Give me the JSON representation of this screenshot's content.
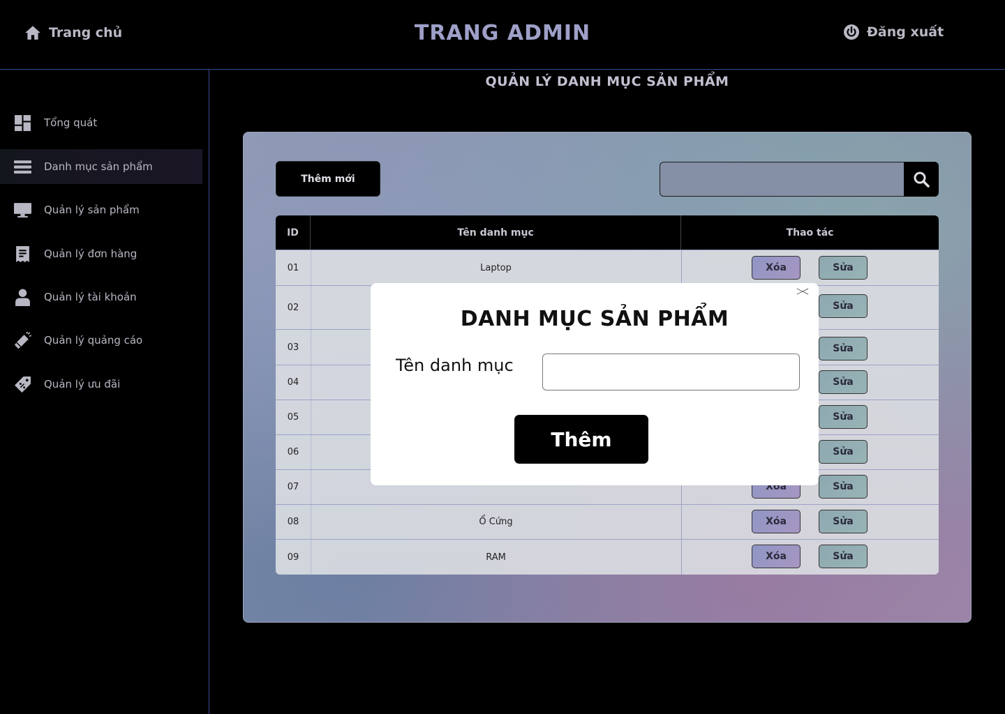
{
  "header": {
    "home_label": "Trang chủ",
    "title": "TRANG ADMIN",
    "logout_label": "Đăng xuất"
  },
  "sidebar": {
    "items": [
      {
        "label": "Tổng quát",
        "icon": "dashboard-icon"
      },
      {
        "label": "Danh mục sản phẩm",
        "icon": "list-icon",
        "active": true
      },
      {
        "label": "Quản lý sản phẩm",
        "icon": "monitor-icon"
      },
      {
        "label": "Quản lý đơn hàng",
        "icon": "receipt-icon"
      },
      {
        "label": "Quản lý tài khoản",
        "icon": "user-icon"
      },
      {
        "label": "Quản lý quảng cáo",
        "icon": "megaphone-icon"
      },
      {
        "label": "Quản lý ưu đãi",
        "icon": "discount-tag-icon"
      }
    ]
  },
  "main": {
    "section_title": "QUẢN LÝ DANH MỤC SẢN PHẨM",
    "add_new_label": "Thêm mới",
    "search": {
      "value": "",
      "icon": "search-icon"
    },
    "table": {
      "columns": [
        "ID",
        "Tên danh mục",
        "Thao tác"
      ],
      "rows": [
        {
          "id": "01",
          "name": "Laptop"
        },
        {
          "id": "02",
          "name": ""
        },
        {
          "id": "03",
          "name": ""
        },
        {
          "id": "04",
          "name": ""
        },
        {
          "id": "05",
          "name": ""
        },
        {
          "id": "06",
          "name": ""
        },
        {
          "id": "07",
          "name": ""
        },
        {
          "id": "08",
          "name": "Ổ Cứng"
        },
        {
          "id": "09",
          "name": "RAM"
        }
      ],
      "delete_label": "Xóa",
      "edit_label": "Sửa"
    }
  },
  "modal": {
    "title": "DANH MỤC SẢN PHẨM",
    "field_label": "Tên danh mục",
    "field_value": "",
    "submit_label": "Thêm",
    "close_icon": "close-icon"
  }
}
